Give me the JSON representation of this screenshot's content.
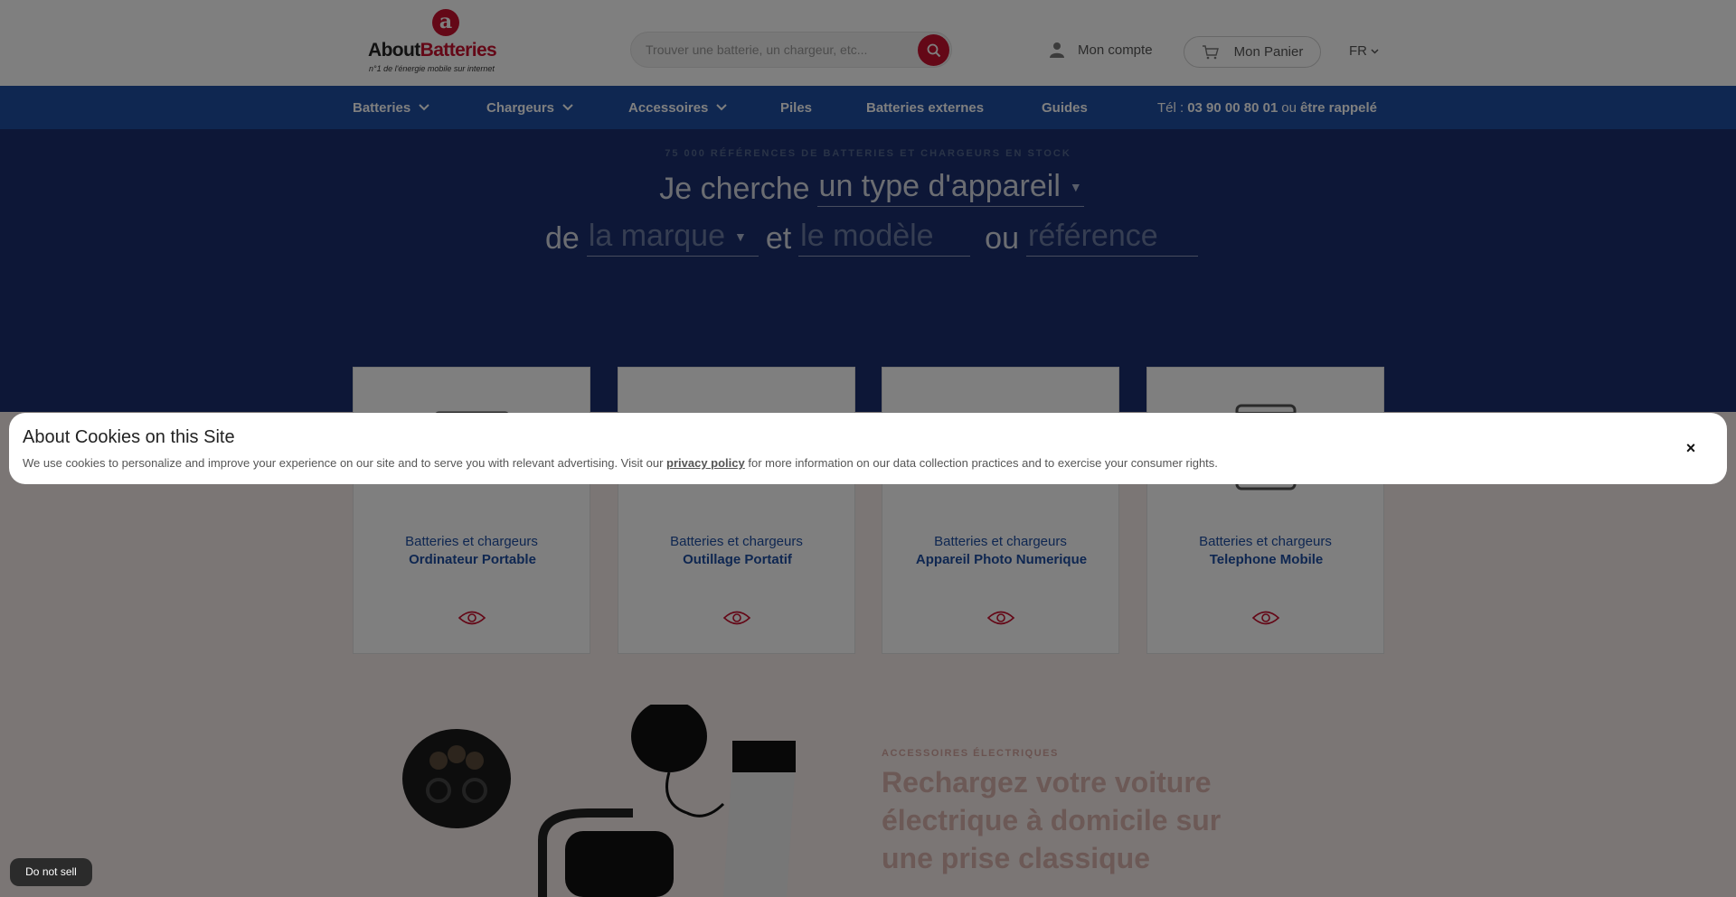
{
  "header": {
    "logo_mark": "a",
    "logo_about": "About",
    "logo_batteries": "Batteries",
    "logo_tagline": "n°1 de l'énergie mobile sur internet",
    "search_placeholder": "Trouver une batterie, un chargeur, etc...",
    "account_label": "Mon compte",
    "cart_label": "Mon Panier",
    "language": "FR"
  },
  "nav": {
    "items": [
      {
        "label": "Batteries",
        "dropdown": true
      },
      {
        "label": "Chargeurs",
        "dropdown": true
      },
      {
        "label": "Accessoires",
        "dropdown": true
      },
      {
        "label": "Piles",
        "dropdown": false
      },
      {
        "label": "Batteries externes",
        "dropdown": false
      },
      {
        "label": "Guides",
        "dropdown": false
      }
    ],
    "phone_prefix": "Tél :",
    "phone_number": "03 90 00 80 01",
    "phone_or": "ou",
    "callback_label": "être rappelé"
  },
  "hero": {
    "kicker": "75 000 RÉFÉRENCES DE BATTERIES ET CHARGEURS EN STOCK",
    "line1_prefix": "Je cherche",
    "device_select": "un type d'appareil",
    "line2_de": "de",
    "brand_select": "la marque",
    "line2_et": "et",
    "model_placeholder": "le modèle",
    "line2_ou": "ou",
    "reference_placeholder": "référence"
  },
  "cards": [
    {
      "subtitle": "Batteries et chargeurs",
      "title": "Ordinateur Portable",
      "icon": "laptop-icon"
    },
    {
      "subtitle": "Batteries et chargeurs",
      "title": "Outillage Portatif",
      "icon": "drill-icon"
    },
    {
      "subtitle": "Batteries et chargeurs",
      "title": "Appareil Photo Numerique",
      "icon": "camera-icon"
    },
    {
      "subtitle": "Batteries et chargeurs",
      "title": "Telephone Mobile",
      "icon": "phone-icon"
    }
  ],
  "promo": {
    "kicker": "ACCESSOIRES ÉLECTRIQUES",
    "title": "Rechargez votre voiture électrique à domicile sur une prise classique"
  },
  "cookie": {
    "title": "About Cookies on this Site",
    "text_before": "We use cookies to personalize and improve your experience on our site and to serve you with relevant advertising. Visit our",
    "link": "privacy policy",
    "text_after": "for more information on our data collection practices and to exercise your consumer rights.",
    "close": "×"
  },
  "do_not_sell": "Do not sell",
  "colors": {
    "brand_red": "#c8102e",
    "nav_blue": "#1e4ea3",
    "hero_navy": "#1b2f6e"
  }
}
